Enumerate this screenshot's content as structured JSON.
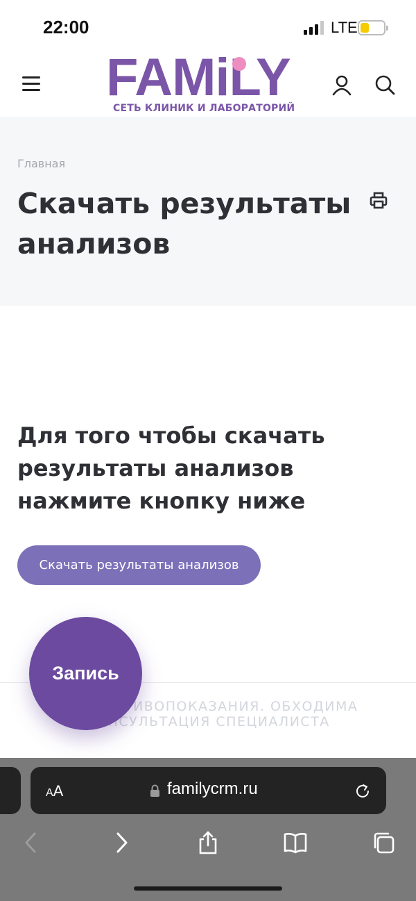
{
  "status_bar": {
    "time": "22:00",
    "network": "LTE"
  },
  "header": {
    "logo_text": "FAMiLY",
    "logo_tagline": "СЕТЬ КЛИНИК И ЛАБОРАТОРИЙ",
    "brand_color": "#7b56a8",
    "icons": [
      "menu-icon",
      "user-icon",
      "search-icon"
    ]
  },
  "page": {
    "breadcrumb": "Главная",
    "title": "Скачать результаты анализов"
  },
  "content": {
    "instruction": "Для того чтобы скачать результаты анализов нажмите кнопку ниже",
    "download_button": "Скачать результаты анализов",
    "button_color": "#7c70b8",
    "warning": "ТСЯ ПРОТИВОПОКАЗАНИЯ. ОБХОДИМА КОНСУЛЬТАЦИЯ СПЕЦИАЛИСТА"
  },
  "fab": {
    "label": "Запись",
    "color": "#6b4a9f"
  },
  "browser": {
    "text_size_label_small": "A",
    "text_size_label_big": "A",
    "url": "familycrm.ru",
    "toolbar_icons": [
      "back-icon",
      "forward-icon",
      "share-icon",
      "bookmarks-icon",
      "tabs-icon"
    ]
  }
}
